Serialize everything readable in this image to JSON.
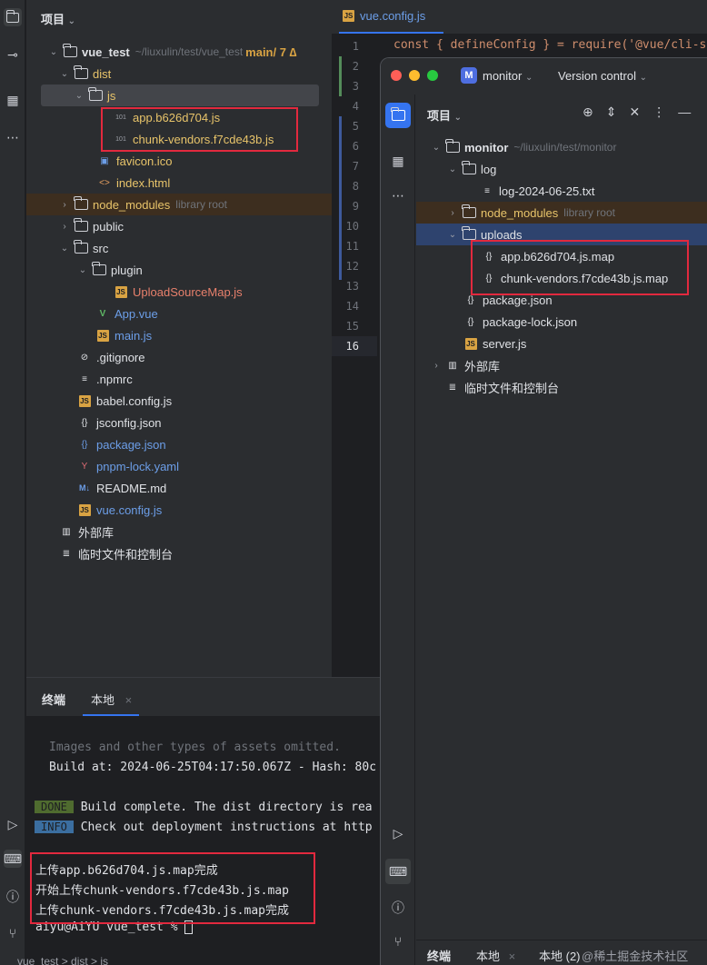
{
  "left_panel": {
    "title": "项目",
    "tree": [
      {
        "label": "vue_test",
        "hint": "~/liuxulin/test/vue_test",
        "branch": "main",
        "extra": "/ 7 ∆"
      },
      {
        "label": "dist"
      },
      {
        "label": "js"
      },
      {
        "label": "app.b626d704.js"
      },
      {
        "label": "chunk-vendors.f7cde43b.js"
      },
      {
        "label": "favicon.ico"
      },
      {
        "label": "index.html"
      },
      {
        "label": "node_modules",
        "hint": "library root"
      },
      {
        "label": "public"
      },
      {
        "label": "src"
      },
      {
        "label": "plugin"
      },
      {
        "label": "UploadSourceMap.js"
      },
      {
        "label": "App.vue"
      },
      {
        "label": "main.js"
      },
      {
        "label": ".gitignore"
      },
      {
        "label": ".npmrc"
      },
      {
        "label": "babel.config.js"
      },
      {
        "label": "jsconfig.json"
      },
      {
        "label": "package.json"
      },
      {
        "label": "pnpm-lock.yaml"
      },
      {
        "label": "README.md"
      },
      {
        "label": "vue.config.js"
      },
      {
        "label": "外部库"
      },
      {
        "label": "临时文件和控制台"
      }
    ]
  },
  "editor": {
    "tab_label": "vue.config.js",
    "line_numbers": [
      "1",
      "2",
      "3",
      "4",
      "5",
      "6",
      "7",
      "8",
      "9",
      "10",
      "11",
      "12",
      "13",
      "14",
      "15",
      "16"
    ],
    "code_line_1": "const { defineConfig } = require('@vue/cli-se"
  },
  "terminal": {
    "tabs": [
      "终端",
      "本地"
    ],
    "lines": [
      "Images and other types of assets omitted.",
      "Build at: 2024-06-25T04:17:50.067Z - Hash: 80c",
      "Build complete. The dist directory is rea",
      "Check out deployment instructions at http",
      "上传app.b626d704.js.map完成",
      "开始上传chunk-vendors.f7cde43b.js.map",
      "上传chunk-vendors.f7cde43b.js.map完成",
      "aiyu@AiYU vue_test % "
    ],
    "done_tag": "DONE",
    "info_tag": "INFO",
    "footer": "vue_test  >  dist  >  js"
  },
  "window": {
    "project_name": "monitor",
    "project_badge": "M",
    "vcs_label": "Version control",
    "panel_title": "项目",
    "tree": [
      {
        "label": "monitor",
        "hint": "~/liuxulin/test/monitor"
      },
      {
        "label": "log"
      },
      {
        "label": "log-2024-06-25.txt"
      },
      {
        "label": "node_modules",
        "hint": "library root"
      },
      {
        "label": "uploads"
      },
      {
        "label": "app.b626d704.js.map"
      },
      {
        "label": "chunk-vendors.f7cde43b.js.map"
      },
      {
        "label": "package.json"
      },
      {
        "label": "package-lock.json"
      },
      {
        "label": "server.js"
      },
      {
        "label": "外部库"
      },
      {
        "label": "临时文件和控制台"
      }
    ],
    "bottom_tabs": [
      "终端",
      "本地",
      "本地 (2)"
    ],
    "watermark": "@稀土掘金技术社区"
  },
  "colors": {
    "accent": "#3574f0",
    "highlight": "#e2293e"
  }
}
